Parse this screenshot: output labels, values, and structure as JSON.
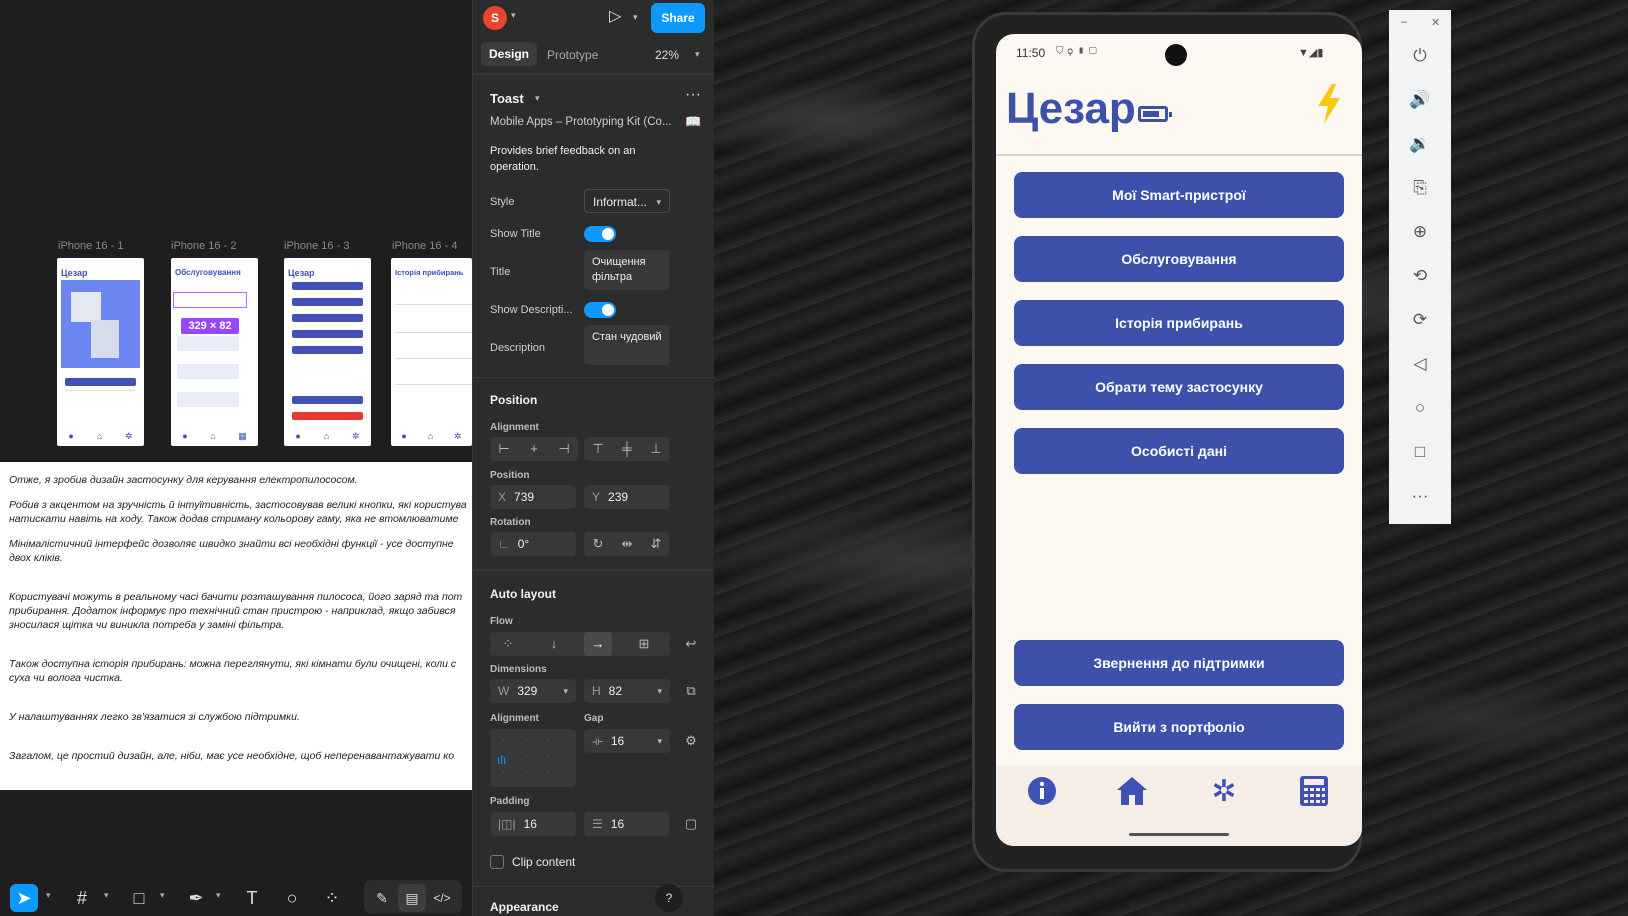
{
  "canvas": {
    "frames": [
      {
        "label": "iPhone 16 - 1",
        "title": "Цезар"
      },
      {
        "label": "iPhone 16 - 2",
        "title": "Обслуговування"
      },
      {
        "label": "iPhone 16 - 3",
        "title": "Цезар"
      },
      {
        "label": "iPhone 16 - 4",
        "title": "Історія прибирань"
      }
    ],
    "selection_badge": "329 × 82",
    "doc_lines": [
      "Отже, я зробив дизайн застосунку для керування електропилососом.",
      "Робив з акцентом на зручність й інтуїтивність, застосовував великі кнопки, які користува",
      "натискати навіть на ходу. Також додав стриману кольорову гаму, яка не втомлюватиме",
      "Мінімалістичний інтерфейс дозволяє швидко знайти всі необхідні функції - усе доступне",
      "двох кліків.",
      "Користувачі можуть в реальному часі бачити розташування пилососа, його заряд та пот",
      "прибирання. Додаток інформує про технічний стан пристрою - наприклад, якщо забився",
      "зносилася щітка чи виникла потреба у заміні фільтра.",
      "Також доступна історія прибирань: можна переглянути, які кімнати були очищені, коли с",
      "суха чи волога чистка.",
      "У налаштуваннях легко зв'язатися зі службою підтримки.",
      "Загалом, це простий дизайн, але, ніби, має усе необхідне, щоб неперенавантажувати ко"
    ]
  },
  "panel": {
    "avatar_letter": "S",
    "share_label": "Share",
    "tab_design": "Design",
    "tab_prototype": "Prototype",
    "zoom": "22%",
    "component_name": "Toast",
    "library": "Mobile Apps – Prototyping Kit (Co...",
    "description_text": "Provides brief feedback on an operation.",
    "style_label": "Style",
    "style_value": "Informat...",
    "show_title_label": "Show Title",
    "title_label": "Title",
    "title_value": "Очищення фільтра",
    "show_description_label": "Show Descripti...",
    "description_label": "Description",
    "description_value": "Стан чудовий",
    "position_section": "Position",
    "alignment_label": "Alignment",
    "position_label": "Position",
    "x_prefix": "X",
    "x_value": "739",
    "y_prefix": "Y",
    "y_value": "239",
    "rotation_label": "Rotation",
    "rotation_value": "0°",
    "autolayout_section": "Auto layout",
    "flow_label": "Flow",
    "dimensions_label": "Dimensions",
    "w_prefix": "W",
    "w_value": "329",
    "h_prefix": "H",
    "h_value": "82",
    "al_alignment_label": "Alignment",
    "gap_label": "Gap",
    "gap_value": "16",
    "padding_label": "Padding",
    "padding_h": "16",
    "padding_v": "16",
    "clip_content": "Clip content",
    "appearance_section": "Appearance",
    "help": "?"
  },
  "phone": {
    "time": "11:50",
    "app_title": "Цезар",
    "buttons": [
      "Мої Smart-пристрої",
      "Обслуговування",
      "Історія прибирань",
      "Обрати тему застосунку",
      "Особисті дані"
    ],
    "bottom_buttons": [
      "Звернення до підтримки",
      "Вийти з портфоліо"
    ],
    "nav_icons": [
      "info-icon",
      "home-icon",
      "settings-icon",
      "calculator-icon"
    ],
    "accent": "#3d51ab",
    "bolt_color": "#f9c80e"
  },
  "emulator_sidebar": {
    "icons": [
      "power-icon",
      "volume-up-icon",
      "volume-down-icon",
      "camera-icon",
      "zoom-in-icon",
      "rotate-left-icon",
      "rotate-right-icon",
      "back-icon",
      "home-icon",
      "overview-icon",
      "more-icon"
    ]
  }
}
